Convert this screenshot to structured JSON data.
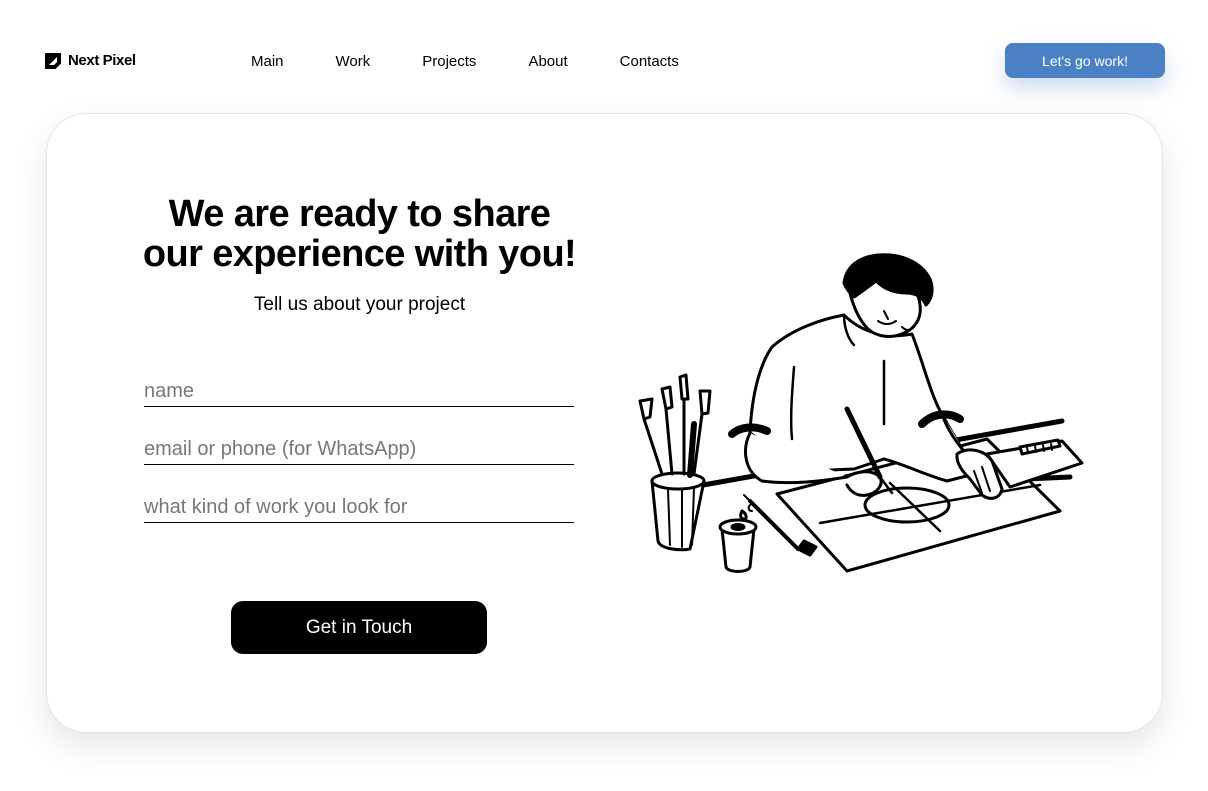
{
  "header": {
    "logo_text": "Next Pixel",
    "nav": [
      "Main",
      "Work",
      "Projects",
      "About",
      "Contacts"
    ],
    "cta_label": "Let's go work!"
  },
  "hero": {
    "headline_line1": "We are ready to share",
    "headline_line2": "our experience with you!",
    "subtitle": "Tell us about your project"
  },
  "form": {
    "name_placeholder": "name",
    "contact_placeholder": "email or phone (for WhatsApp)",
    "work_placeholder": "what kind of work you look for",
    "submit_label": "Get in Touch"
  },
  "illustration": {
    "icon": "artist-drawing-illustration"
  },
  "colors": {
    "accent": "#4a81c4",
    "primary_button": "#000000",
    "card_border": "#e4e4e4",
    "placeholder_text": "#777777"
  }
}
